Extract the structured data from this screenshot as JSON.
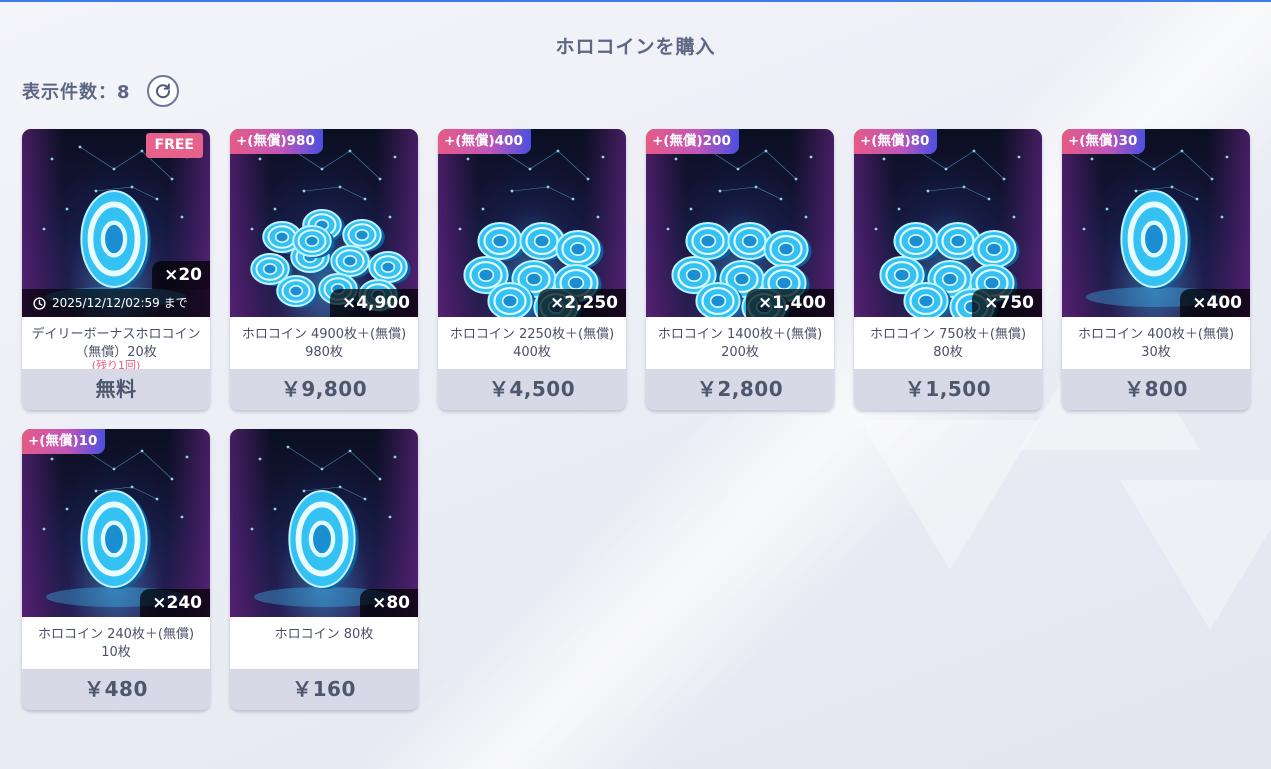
{
  "header": {
    "title": "ホロコインを購入"
  },
  "listing": {
    "count_label": "表示件数：8"
  },
  "colors": {
    "badge_pink": "#e65a86",
    "badge_blue": "#4a4fe0",
    "free_badge": "#e7628b",
    "price_bg": "#d7dae6",
    "remain_text": "#e55f86"
  },
  "products": [
    {
      "badge": "",
      "free_badge": "FREE",
      "quantity": "×20",
      "timer": "2025/12/12/02:59 まで",
      "name": "デイリーボーナスホロコイン（無償）20枚",
      "remaining": "(残り1回)",
      "price": "無料",
      "art": "single-coin"
    },
    {
      "badge": "+(無償)980",
      "free_badge": "",
      "quantity": "×4,900",
      "timer": "",
      "name": "ホロコイン 4900枚＋(無償) 980枚",
      "remaining": "",
      "price": "￥9,800",
      "art": "coin-pile-large"
    },
    {
      "badge": "+(無償)400",
      "free_badge": "",
      "quantity": "×2,250",
      "timer": "",
      "name": "ホロコイン 2250枚＋(無償) 400枚",
      "remaining": "",
      "price": "￥4,500",
      "art": "coin-stacks"
    },
    {
      "badge": "+(無償)200",
      "free_badge": "",
      "quantity": "×1,400",
      "timer": "",
      "name": "ホロコイン 1400枚＋(無償) 200枚",
      "remaining": "",
      "price": "￥2,800",
      "art": "coin-stacks"
    },
    {
      "badge": "+(無償)80",
      "free_badge": "",
      "quantity": "×750",
      "timer": "",
      "name": "ホロコイン 750枚＋(無償) 80枚",
      "remaining": "",
      "price": "￥1,500",
      "art": "coin-stacks"
    },
    {
      "badge": "+(無償)30",
      "free_badge": "",
      "quantity": "×400",
      "timer": "",
      "name": "ホロコイン 400枚＋(無償) 30枚",
      "remaining": "",
      "price": "￥800",
      "art": "single-coin"
    },
    {
      "badge": "+(無償)10",
      "free_badge": "",
      "quantity": "×240",
      "timer": "",
      "name": "ホロコイン 240枚＋(無償) 10枚",
      "remaining": "",
      "price": "￥480",
      "art": "single-coin"
    },
    {
      "badge": "",
      "free_badge": "",
      "quantity": "×80",
      "timer": "",
      "name": "ホロコイン 80枚",
      "remaining": "",
      "price": "￥160",
      "art": "single-coin"
    }
  ]
}
